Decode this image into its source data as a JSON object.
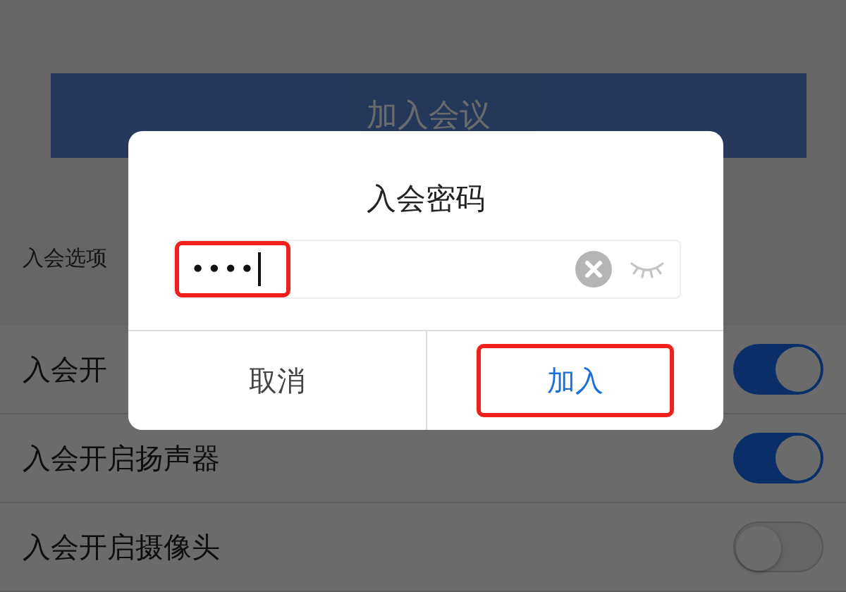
{
  "join_button": {
    "label": "加入会议",
    "disabled": true
  },
  "options_label": "入会选项",
  "options": [
    {
      "label": "入会开",
      "on": true
    },
    {
      "label": "入会开启扬声器",
      "on": true
    },
    {
      "label": "入会开启摄像头",
      "on": false
    }
  ],
  "dialog": {
    "title": "入会密码",
    "password": {
      "value": "••••",
      "highlighted": true
    },
    "buttons": [
      {
        "label": "取消",
        "kind": "cancel",
        "highlighted": false
      },
      {
        "label": "加入",
        "kind": "confirm",
        "highlighted": true
      }
    ]
  }
}
